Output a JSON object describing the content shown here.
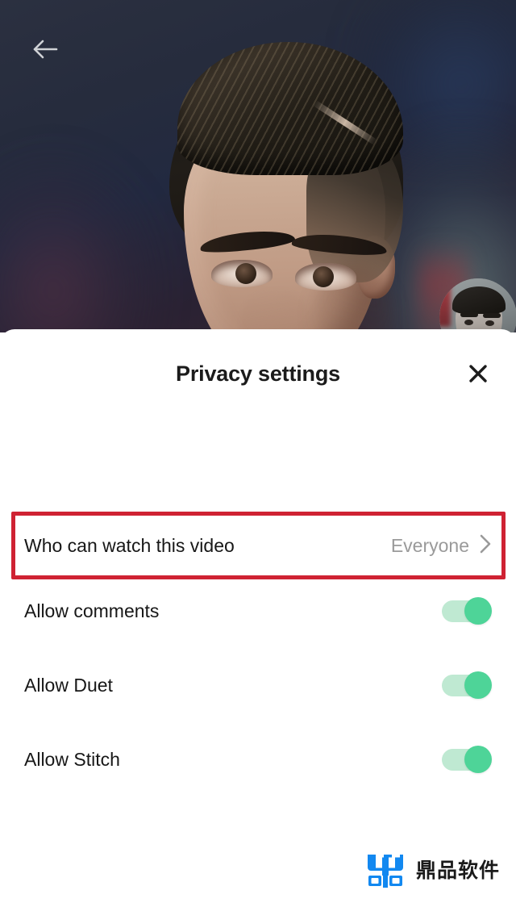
{
  "video": {
    "back_icon": "back-arrow-icon",
    "avatar_label": "creator-avatar",
    "description": "TikTok video playing behind the privacy settings sheet showing a close-up of a man's face"
  },
  "sheet": {
    "title": "Privacy settings",
    "close_icon": "close-x-icon",
    "who_can_watch": {
      "label": "Who can watch this video",
      "value": "Everyone",
      "chevron_icon": "chevron-right-icon",
      "highlighted": true,
      "highlight_color": "#cf2233"
    },
    "toggles": [
      {
        "label": "Allow comments",
        "state": "on"
      },
      {
        "label": "Allow Duet",
        "state": "on"
      },
      {
        "label": "Allow Stitch",
        "state": "on"
      }
    ],
    "toggle_on_color": "#4ed498",
    "toggle_track_color": "#bfe9d2"
  },
  "watermark": {
    "text": "鼎品软件",
    "logo_icon": "ding-logo-icon",
    "logo_color": "#1288f0"
  }
}
